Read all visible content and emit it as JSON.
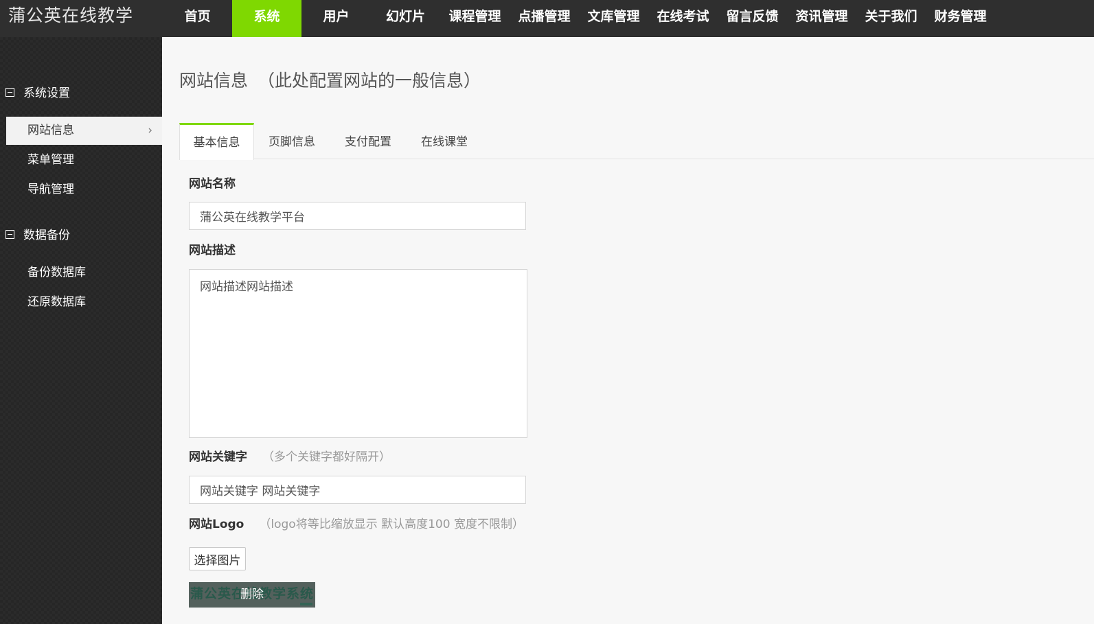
{
  "app": {
    "brand": "蒲公英在线教学"
  },
  "topnav": {
    "items": [
      "首页",
      "系统",
      "用户",
      "幻灯片",
      "课程管理",
      "点播管理",
      "文库管理",
      "在线考试",
      "留言反馈",
      "资讯管理",
      "关于我们",
      "财务管理"
    ],
    "active": "系统"
  },
  "sidebar": {
    "groups": [
      {
        "title": "系统设置",
        "items": [
          "网站信息",
          "菜单管理",
          "导航管理"
        ]
      },
      {
        "title": "数据备份",
        "items": [
          "备份数据库",
          "还原数据库"
        ]
      }
    ],
    "active_item": "网站信息"
  },
  "page": {
    "title": "网站信息",
    "title_note": "（此处配置网站的一般信息）"
  },
  "tabs": [
    "基本信息",
    "页脚信息",
    "支付配置",
    "在线课堂"
  ],
  "form": {
    "site_name": {
      "label": "网站名称",
      "value": "蒲公英在线教学平台"
    },
    "site_desc": {
      "label": "网站描述",
      "value": "网站描述网站描述"
    },
    "site_keywords": {
      "label": "网站关键字",
      "hint": "（多个关键字都好隔开）",
      "value": "网站关键字 网站关键字"
    },
    "site_logo": {
      "label": "网站Logo",
      "hint": "（logo将等比缩放显示 默认高度100 宽度不限制）",
      "choose_label": "选择图片",
      "delete_label": "删除",
      "logo_text": "蒲公英在线教学系统"
    }
  },
  "colors": {
    "accent": "#7fd801",
    "topbar": "#2f2f2f",
    "sidebar": "#2b2b2b"
  }
}
